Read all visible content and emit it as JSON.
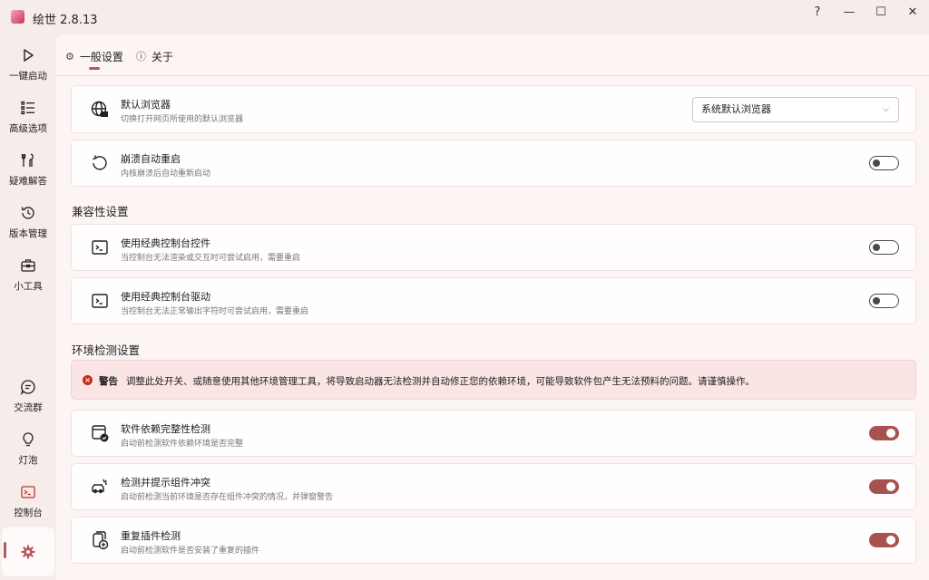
{
  "window": {
    "title": "绘世 2.8.13",
    "controls": {
      "help": "?",
      "minimize": "—",
      "maximize": "☐",
      "close": "✕"
    }
  },
  "sidebar": {
    "items": [
      {
        "label": "一键启动",
        "icon": "play-icon"
      },
      {
        "label": "高级选项",
        "icon": "list-icon"
      },
      {
        "label": "疑难解答",
        "icon": "tools-icon"
      },
      {
        "label": "版本管理",
        "icon": "history-icon"
      },
      {
        "label": "小工具",
        "icon": "toolbox-icon"
      },
      {
        "label": "交流群",
        "icon": "chat-icon"
      },
      {
        "label": "灯泡",
        "icon": "lightbulb-icon"
      },
      {
        "label": "控制台",
        "icon": "console-icon"
      }
    ],
    "settings_icon": "gear-icon"
  },
  "tabs": [
    {
      "label": "一般设置",
      "icon": "gear-icon",
      "active": true
    },
    {
      "label": "关于",
      "icon": "info-icon",
      "active": false
    }
  ],
  "general": {
    "browser": {
      "title": "默认浏览器",
      "desc": "切换打开网页所使用的默认浏览器",
      "selected": "系统默认浏览器"
    },
    "crash_restart": {
      "title": "崩溃自动重启",
      "desc": "内核崩溃后自动重新启动",
      "enabled": false
    }
  },
  "compat": {
    "title": "兼容性设置",
    "classic_console_ctrl": {
      "title": "使用经典控制台控件",
      "desc": "当控制台无法渲染或交互时可尝试启用，需要重启",
      "enabled": false
    },
    "classic_console_driver": {
      "title": "使用经典控制台驱动",
      "desc": "当控制台无法正常输出字符时可尝试启用，需要重启",
      "enabled": false
    }
  },
  "env": {
    "title": "环境检测设置",
    "warning_title": "警告",
    "warning_text": "调整此处开关、或随意使用其他环境管理工具，将导致启动器无法检测并自动修正您的依赖环境，可能导致软件包产生无法预料的问题。请谨慎操作。",
    "dep_check": {
      "title": "软件依赖完整性检测",
      "desc": "启动前检测软件依赖环境是否完整",
      "enabled": true
    },
    "conflict_check": {
      "title": "检测并提示组件冲突",
      "desc": "启动前检测当前环境是否存在组件冲突的情况，并弹窗警告",
      "enabled": true
    },
    "dup_plugin_check": {
      "title": "重复插件检测",
      "desc": "启动前检测软件是否安装了重复的插件",
      "enabled": true
    }
  },
  "colors": {
    "accent": "#a6534f",
    "warning_bg": "#fbe4e4",
    "error_icon": "#c42b1c"
  }
}
